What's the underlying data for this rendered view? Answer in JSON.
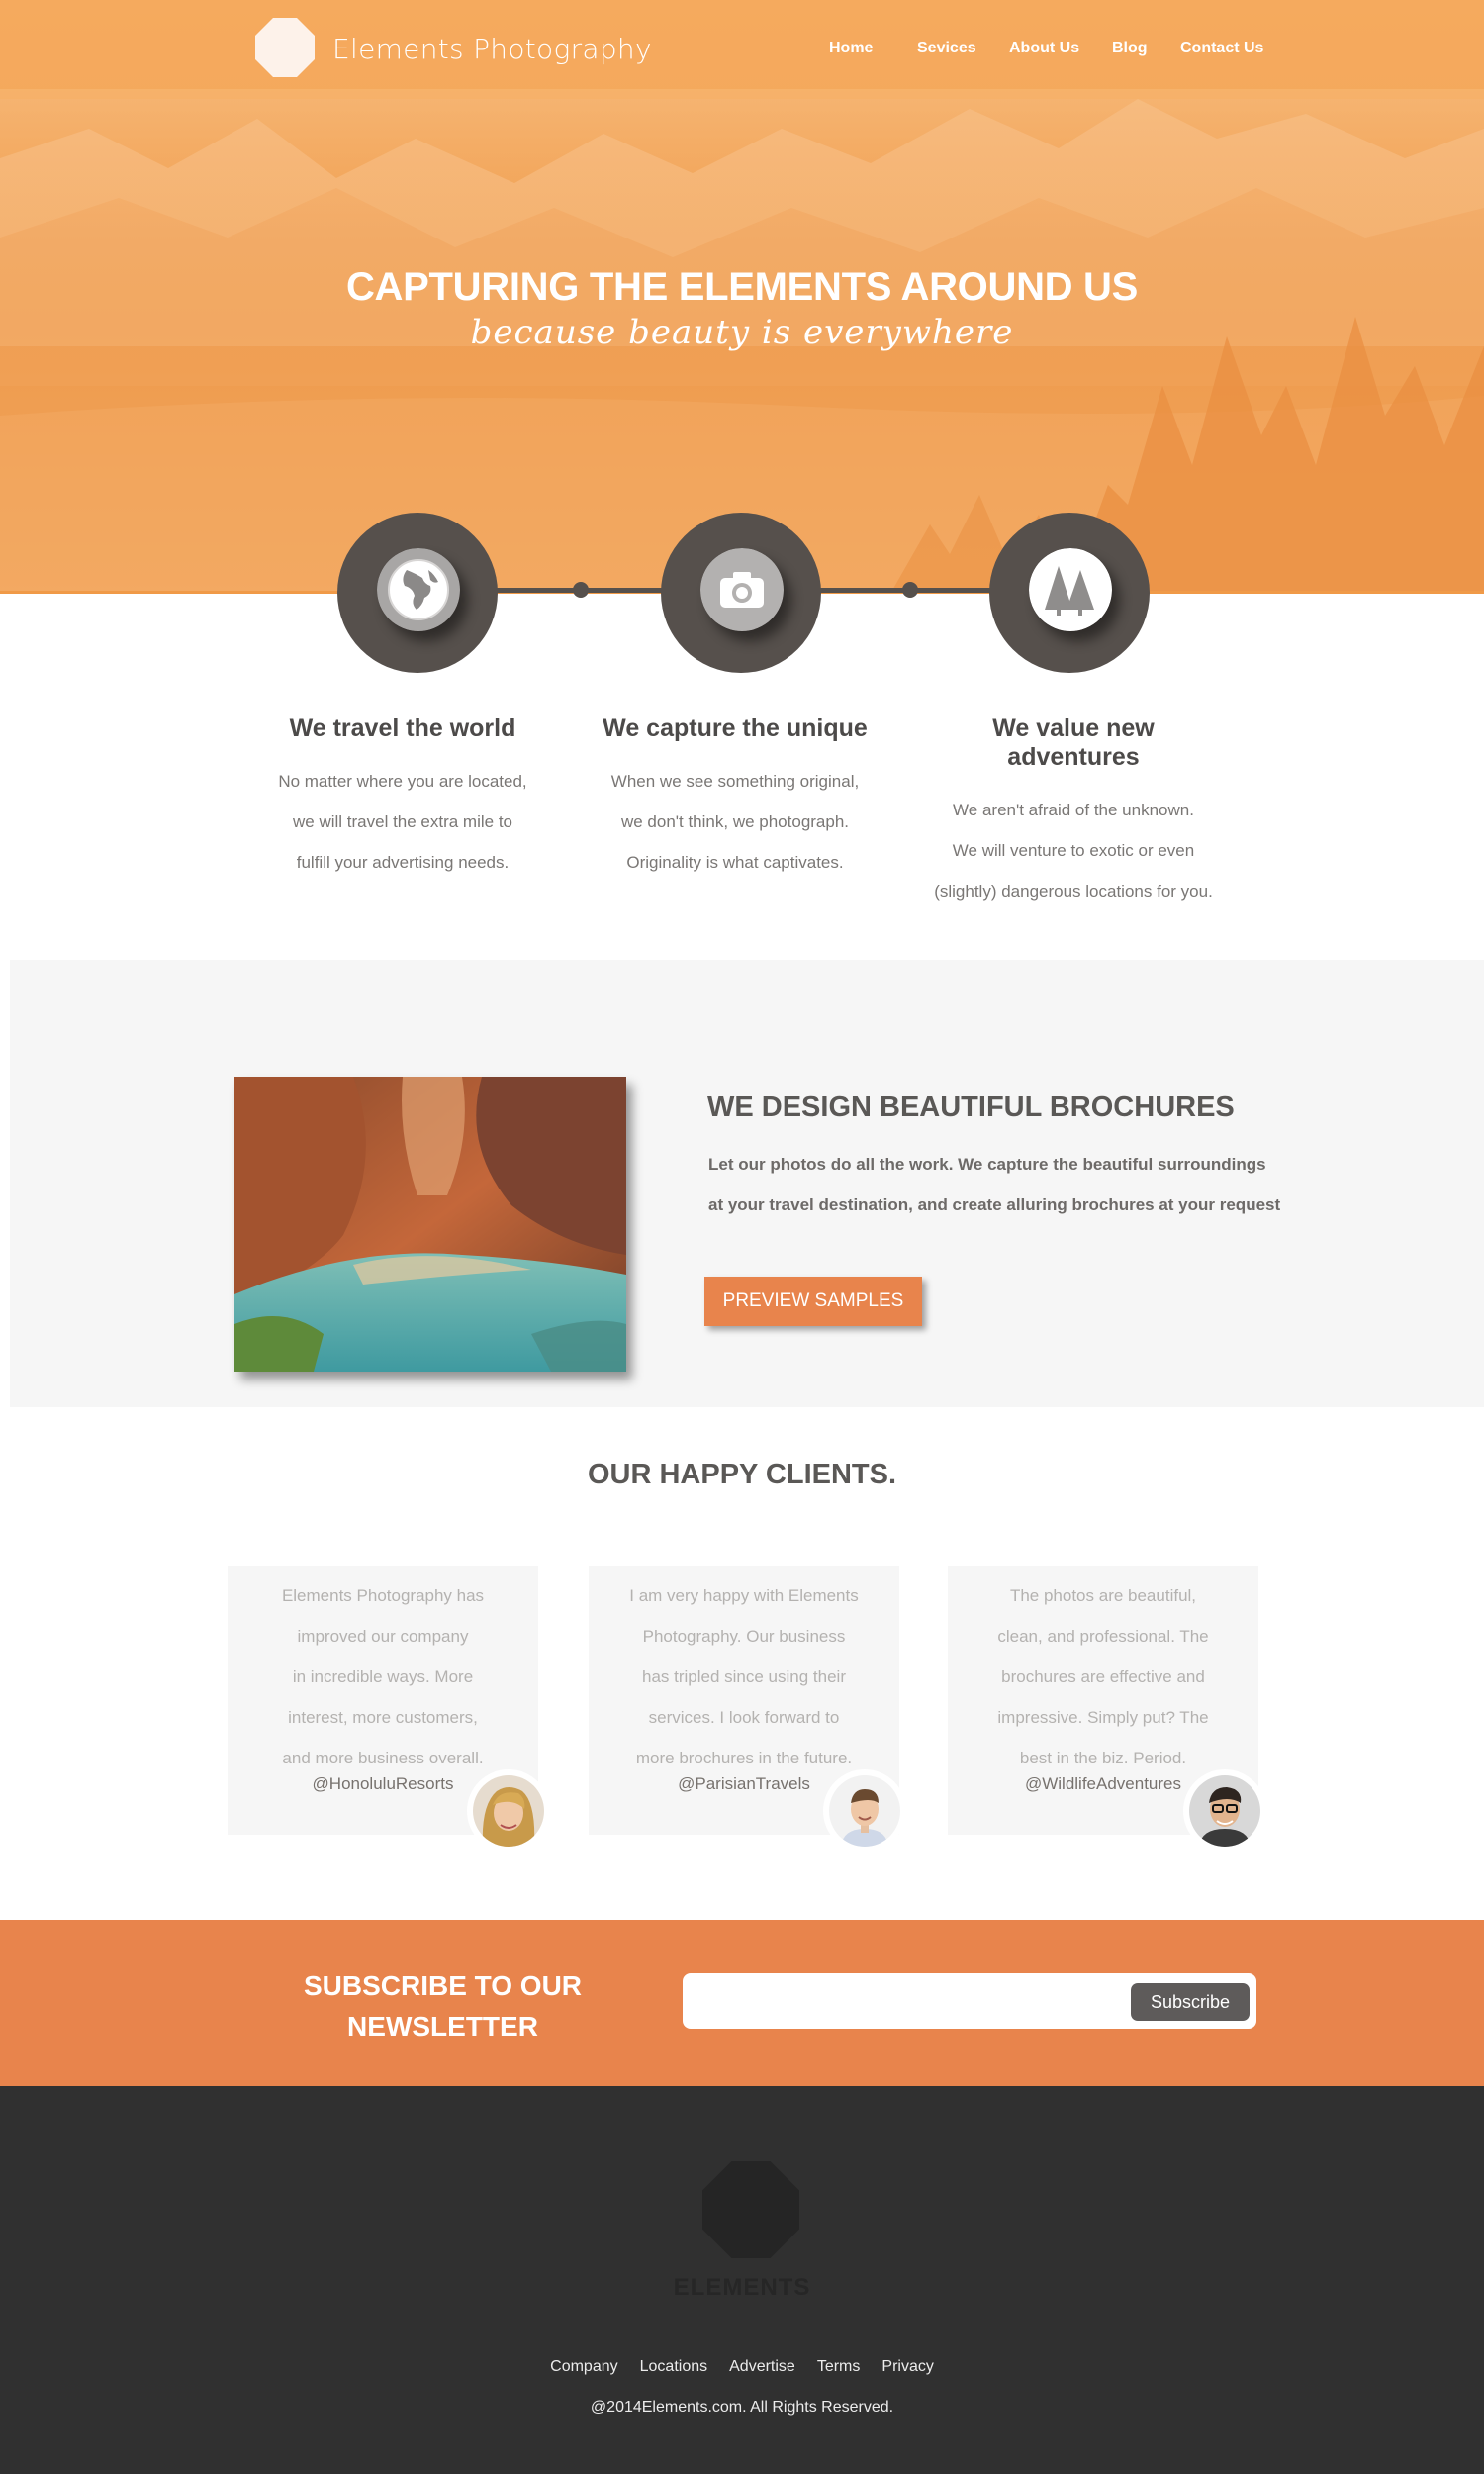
{
  "colors": {
    "accent_orange": "#e8844c",
    "hero_orange": "#f1a050",
    "dark_circle": "#56504c",
    "footer_bg": "#303030",
    "light_section": "#f6f6f6"
  },
  "header": {
    "logo_text": "Elements Photography",
    "logo_icon": "octagon-logo-icon",
    "nav": [
      {
        "label": "Home"
      },
      {
        "label": "Sevices"
      },
      {
        "label": "About Us"
      },
      {
        "label": "Blog"
      },
      {
        "label": "Contact Us"
      }
    ]
  },
  "hero": {
    "title": "CAPTURING THE ELEMENTS AROUND US",
    "subtitle": "because beauty is everywhere"
  },
  "features": [
    {
      "icon": "globe-icon",
      "title": "We travel the world",
      "lines": [
        "No matter where you are located,",
        "we will travel the extra mile to",
        "fulfill your advertising needs."
      ]
    },
    {
      "icon": "camera-icon",
      "title": "We capture the unique",
      "lines": [
        "When we see something original,",
        "we don't think, we photograph.",
        "Originality is what captivates."
      ]
    },
    {
      "icon": "trees-icon",
      "title": "We value new adventures",
      "lines": [
        "We aren't afraid of the unknown.",
        "We will venture to exotic or even",
        "(slightly) dangerous locations for you."
      ]
    }
  ],
  "brochures": {
    "title": "WE DESIGN BEAUTIFUL BROCHURES",
    "lines": [
      "Let our photos do all the work. We capture the beautiful surroundings",
      "at your travel destination, and create alluring brochures at your request"
    ],
    "button_label": "PREVIEW SAMPLES"
  },
  "clients": {
    "title": "OUR HAPPY CLIENTS.",
    "items": [
      {
        "lines": [
          "Elements Photography has",
          "improved our company",
          "in incredible ways.  More",
          "interest, more customers,",
          "and more business overall."
        ],
        "handle": "@HonoluluResorts"
      },
      {
        "lines": [
          "I am very happy with Elements",
          "Photography.  Our business",
          "has tripled since using their",
          "services. I look forward to",
          "more brochures in the future."
        ],
        "handle": "@ParisianTravels"
      },
      {
        "lines": [
          "The photos are beautiful,",
          "clean, and professional.  The",
          "brochures are effective and",
          "impressive. Simply put? The",
          "best in the biz. Period."
        ],
        "handle": "@WildlifeAdventures"
      }
    ]
  },
  "newsletter": {
    "title_line1": "SUBSCRIBE TO OUR",
    "title_line2": "NEWSLETTER",
    "input_value": "",
    "button_label": "Subscribe"
  },
  "footer": {
    "logo_text": "ELEMENTS",
    "links": [
      {
        "label": "Company"
      },
      {
        "label": "Locations"
      },
      {
        "label": "Advertise"
      },
      {
        "label": "Terms"
      },
      {
        "label": "Privacy"
      }
    ],
    "copyright": "@2014Elements.com. All Rights Reserved."
  }
}
